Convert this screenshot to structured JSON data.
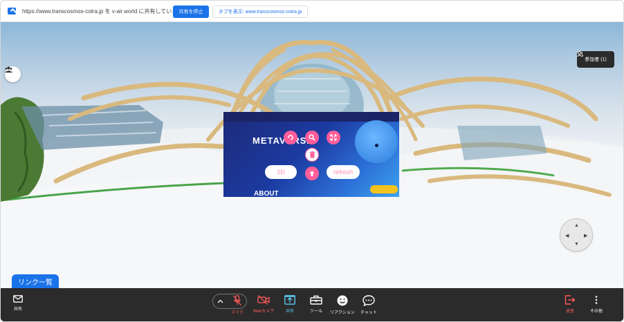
{
  "share_bar": {
    "message": "https://www.transcosmos-cotra.jp を v-air.world に共有しています",
    "stop_label": "共有を停止",
    "show_tab_label": "タブを表示: www.transcosmos-cotra.jp",
    "accent": "#1a73e8"
  },
  "scene": {
    "participants_label": "参加者 (1)",
    "screen": {
      "metaverse_title": "METAVERSE",
      "about_label": "ABOUT",
      "btn_2d": "2D",
      "btn_refresh": "refresh"
    }
  },
  "link_list_label": "リンク一覧",
  "toolbar": {
    "mail_label": "共有",
    "mic_label": "マイク",
    "camera_label": "Webカメラ",
    "share_label": "共有",
    "tools_label": "ツール",
    "reaction_label": "リアクション",
    "chat_label": "チャット",
    "leave_label": "退室",
    "more_label": "その他",
    "colors": {
      "bar": "#2b2b2b",
      "red": "#ff5a5a",
      "cyan": "#5bc8f0"
    }
  }
}
